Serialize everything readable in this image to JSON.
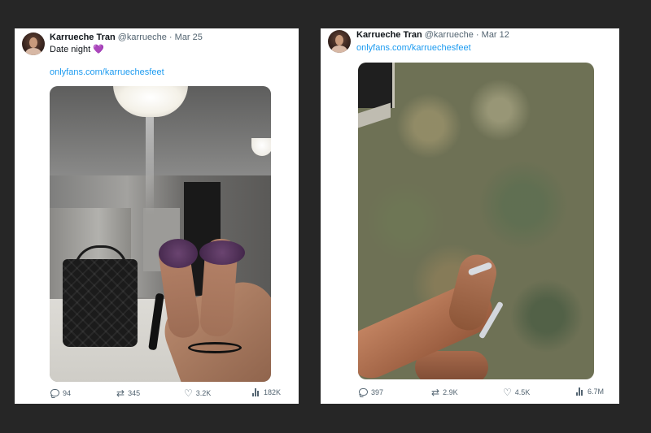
{
  "tweets": [
    {
      "name": "Karrueche Tran",
      "handle": "@karrueche",
      "separator": "·",
      "date": "Mar 25",
      "text": "Date night",
      "emoji": "💜",
      "link": "onlyfans.com/karruechesfeet",
      "stats": {
        "replies": "94",
        "retweets": "345",
        "likes": "3.2K",
        "views": "182K"
      }
    },
    {
      "name": "Karrueche Tran",
      "handle": "@karrueche",
      "separator": "·",
      "date": "Mar 12",
      "link": "onlyfans.com/karruechesfeet",
      "stats": {
        "replies": "397",
        "retweets": "2.9K",
        "likes": "4.5K",
        "views": "6.7M"
      }
    }
  ],
  "icons": {
    "reply": "reply-icon",
    "retweet": "retweet-icon",
    "like": "heart-icon",
    "views": "bar-chart-icon"
  },
  "colors": {
    "background": "#262626",
    "card": "#ffffff",
    "link": "#1d9bf0",
    "muted": "#536471"
  }
}
